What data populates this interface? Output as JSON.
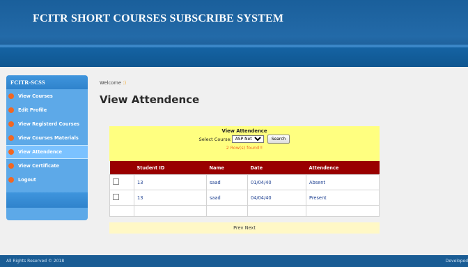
{
  "header": {
    "title": "FCITR SHORT COURSES SUBSCRIBE SYSTEM"
  },
  "sidebar": {
    "title": "FCITR-SCSS",
    "items": [
      {
        "label": "View Courses"
      },
      {
        "label": "Edit Profile"
      },
      {
        "label": "View Registerd Courses"
      },
      {
        "label": "View Courses Materials"
      },
      {
        "label": "View Attendence",
        "active": true
      },
      {
        "label": "View Certificate"
      },
      {
        "label": "Logout"
      }
    ]
  },
  "main": {
    "welcome": "Welcome",
    "welcome_suffix": ":)",
    "page_title": "View Attendence",
    "panel": {
      "title": "View Attendence",
      "select_label": "Select Course:",
      "select_value": "ASP Net",
      "search_label": "Search",
      "found_text": "2 Row(s) found!!"
    },
    "table": {
      "headers": [
        "",
        "Student ID",
        "Name",
        "Date",
        "Attendence"
      ],
      "rows": [
        {
          "student_id": "13",
          "name": "saad",
          "date": "01/04/40",
          "attendence": "Absent"
        },
        {
          "student_id": "13",
          "name": "saad",
          "date": "04/04/40",
          "attendence": "Present"
        }
      ]
    },
    "pager": {
      "prev": "Prev",
      "next": "Next"
    }
  },
  "footer": {
    "copyright": "All Rights Reserved © 2018",
    "developer": "Developed"
  },
  "colors": {
    "header": "#1a5f9b",
    "sidebar": "#5da9e8",
    "table_header": "#990000",
    "panel": "#ffff80",
    "accent": "#f26722"
  }
}
